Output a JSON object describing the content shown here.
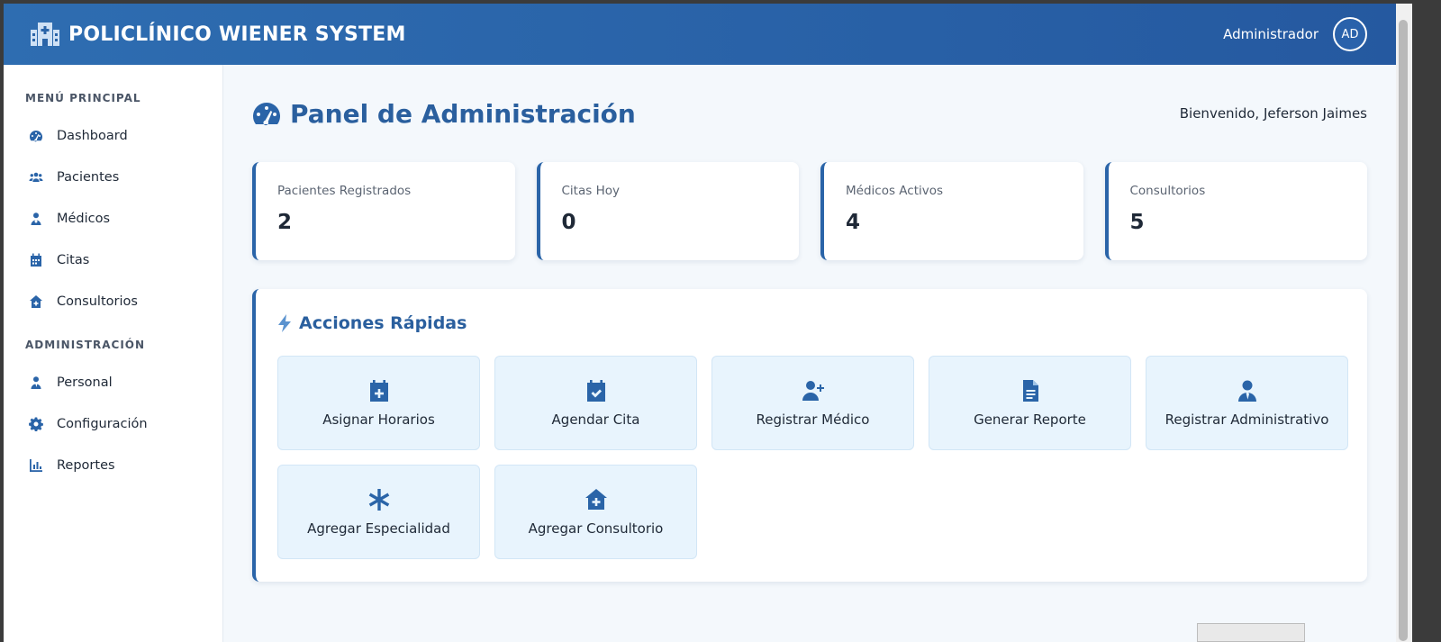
{
  "app": {
    "title": "POLICLÍNICO WIENER SYSTEM",
    "user_role": "Administrador",
    "avatar_initials": "AD",
    "brand_color": "#2a64a8"
  },
  "sidebar": {
    "sections": [
      {
        "heading": "MENÚ PRINCIPAL",
        "items": [
          {
            "label": "Dashboard",
            "icon": "gauge-icon"
          },
          {
            "label": "Pacientes",
            "icon": "users-icon"
          },
          {
            "label": "Médicos",
            "icon": "doctor-icon"
          },
          {
            "label": "Citas",
            "icon": "calendar-icon"
          },
          {
            "label": "Consultorios",
            "icon": "clinic-icon"
          }
        ]
      },
      {
        "heading": "ADMINISTRACIÓN",
        "items": [
          {
            "label": "Personal",
            "icon": "user-tie-icon"
          },
          {
            "label": "Configuración",
            "icon": "gear-icon"
          },
          {
            "label": "Reportes",
            "icon": "chart-icon"
          }
        ]
      }
    ]
  },
  "main": {
    "title": "Panel de Administración",
    "welcome": "Bienvenido, Jeferson Jaimes",
    "stats": [
      {
        "label": "Pacientes Registrados",
        "value": "2"
      },
      {
        "label": "Citas Hoy",
        "value": "0"
      },
      {
        "label": "Médicos Activos",
        "value": "4"
      },
      {
        "label": "Consultorios",
        "value": "5"
      }
    ],
    "quick_actions": {
      "title": "Acciones Rápidas",
      "items": [
        {
          "label": "Asignar Horarios",
          "icon": "calendar-plus-icon"
        },
        {
          "label": "Agendar Cita",
          "icon": "calendar-check-icon"
        },
        {
          "label": "Registrar Médico",
          "icon": "user-plus-icon"
        },
        {
          "label": "Generar Reporte",
          "icon": "file-icon"
        },
        {
          "label": "Registrar Administrativo",
          "icon": "user-tie-icon"
        },
        {
          "label": "Agregar Especialidad",
          "icon": "asterisk-icon"
        },
        {
          "label": "Agregar Consultorio",
          "icon": "clinic-plus-icon"
        }
      ]
    }
  }
}
